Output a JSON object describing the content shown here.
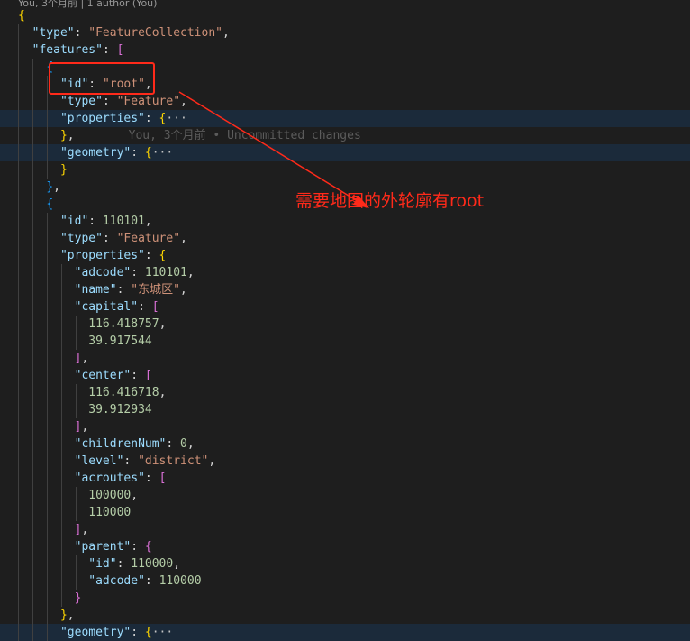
{
  "codelens": "You, 3个月前 | 1 author (You)",
  "lines": {
    "l0": {
      "b": "{"
    },
    "l1": {
      "key": "\"type\"",
      "sep": ": ",
      "val": "\"FeatureCollection\"",
      "end": ","
    },
    "l2": {
      "key": "\"features\"",
      "sep": ": ",
      "br": "["
    },
    "l3": {
      "br": "{"
    },
    "l4": {
      "key": "\"id\"",
      "sep": ": ",
      "val": "\"root\"",
      "end": ","
    },
    "l5": {
      "key": "\"type\"",
      "sep": ": ",
      "val": "\"Feature\"",
      "end": ","
    },
    "l6": {
      "key": "\"properties\"",
      "sep": ": ",
      "br": "{",
      "ell": "···"
    },
    "l7": {
      "br": "}",
      "end": ",",
      "blame": "You, 3个月前 • Uncommitted changes"
    },
    "l8": {
      "key": "\"geometry\"",
      "sep": ": ",
      "br": "{",
      "ell": "···"
    },
    "l9": {
      "br": "}"
    },
    "l10": {
      "br": "}",
      "end": ","
    },
    "l11": {
      "br": "{"
    },
    "l12": {
      "key": "\"id\"",
      "sep": ": ",
      "val": "110101",
      "end": ","
    },
    "l13": {
      "key": "\"type\"",
      "sep": ": ",
      "val": "\"Feature\"",
      "end": ","
    },
    "l14": {
      "key": "\"properties\"",
      "sep": ": ",
      "br": "{"
    },
    "l15": {
      "key": "\"adcode\"",
      "sep": ": ",
      "val": "110101",
      "end": ","
    },
    "l16": {
      "key": "\"name\"",
      "sep": ": ",
      "val": "\"东城区\"",
      "end": ","
    },
    "l17": {
      "key": "\"capital\"",
      "sep": ": ",
      "br": "["
    },
    "l18": {
      "val": "116.418757",
      "end": ","
    },
    "l19": {
      "val": "39.917544"
    },
    "l20": {
      "br": "]",
      "end": ","
    },
    "l21": {
      "key": "\"center\"",
      "sep": ": ",
      "br": "["
    },
    "l22": {
      "val": "116.416718",
      "end": ","
    },
    "l23": {
      "val": "39.912934"
    },
    "l24": {
      "br": "]",
      "end": ","
    },
    "l25": {
      "key": "\"childrenNum\"",
      "sep": ": ",
      "val": "0",
      "end": ","
    },
    "l26": {
      "key": "\"level\"",
      "sep": ": ",
      "val": "\"district\"",
      "end": ","
    },
    "l27": {
      "key": "\"acroutes\"",
      "sep": ": ",
      "br": "["
    },
    "l28": {
      "val": "100000",
      "end": ","
    },
    "l29": {
      "val": "110000"
    },
    "l30": {
      "br": "]",
      "end": ","
    },
    "l31": {
      "key": "\"parent\"",
      "sep": ": ",
      "br": "{"
    },
    "l32": {
      "key": "\"id\"",
      "sep": ": ",
      "val": "110000",
      "end": ","
    },
    "l33": {
      "key": "\"adcode\"",
      "sep": ": ",
      "val": "110000"
    },
    "l34": {
      "br": "}"
    },
    "l35": {
      "br": "}",
      "end": ","
    },
    "l36": {
      "key": "\"geometry\"",
      "sep": ": ",
      "br": "{",
      "ell": "···"
    }
  },
  "annotation": {
    "text": "需要地图的外轮廓有root",
    "color": "#ff2a1a"
  },
  "icons": {
    "fold": "chevron-right-icon"
  },
  "colors": {
    "background": "#1e1e1e",
    "key": "#9cdcfe",
    "string": "#ce9178",
    "number": "#b5cea8",
    "bracket_level1": "#ffd700",
    "bracket_level2": "#da70d6",
    "bracket_level3": "#179fff",
    "folded_line_highlight": "#1b2a3a"
  }
}
